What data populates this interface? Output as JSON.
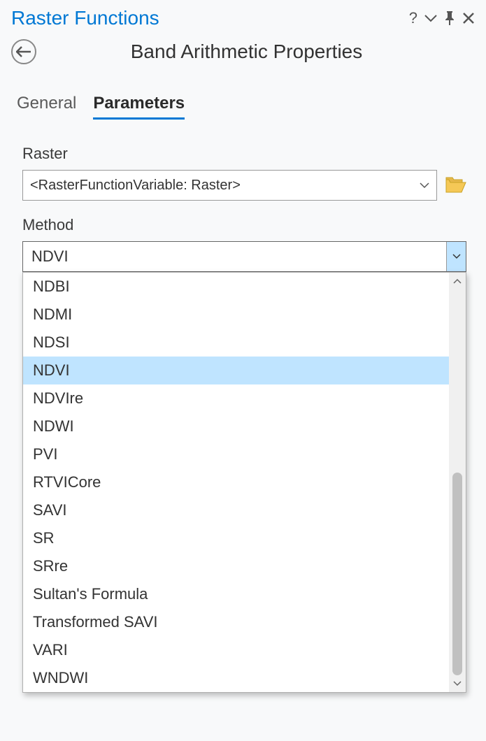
{
  "header": {
    "title": "Raster Functions"
  },
  "subheader": {
    "title": "Band Arithmetic Properties"
  },
  "tabs": [
    {
      "label": "General",
      "active": false
    },
    {
      "label": "Parameters",
      "active": true
    }
  ],
  "form": {
    "raster": {
      "label": "Raster",
      "value": "<RasterFunctionVariable: Raster>"
    },
    "method": {
      "label": "Method",
      "value": "NDVI",
      "options": [
        "NDBI",
        "NDMI",
        "NDSI",
        "NDVI",
        "NDVIre",
        "NDWI",
        "PVI",
        "RTVICore",
        "SAVI",
        "SR",
        "SRre",
        "Sultan's Formula",
        "Transformed SAVI",
        "VARI",
        "WNDWI"
      ],
      "selected": "NDVI"
    }
  }
}
